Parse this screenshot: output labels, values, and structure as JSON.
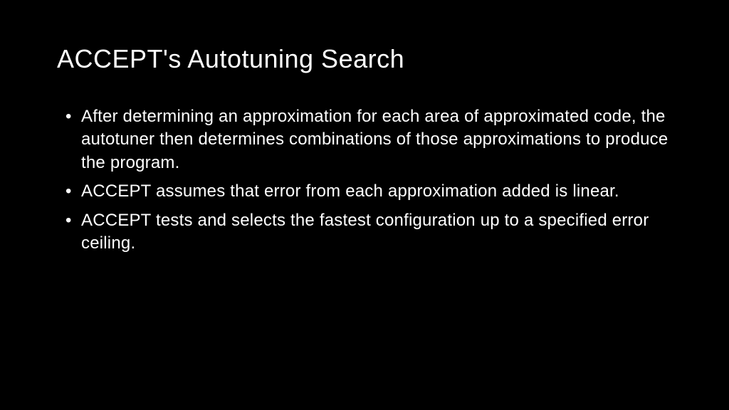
{
  "slide": {
    "title": "ACCEPT's Autotuning Search",
    "bullets": [
      "After determining an approximation for each area of approximated code, the autotuner then determines combinations of those approximations to produce the program.",
      "ACCEPT assumes that error from each approximation added is linear.",
      "ACCEPT tests and selects the fastest configuration up to a specified error ceiling."
    ]
  }
}
